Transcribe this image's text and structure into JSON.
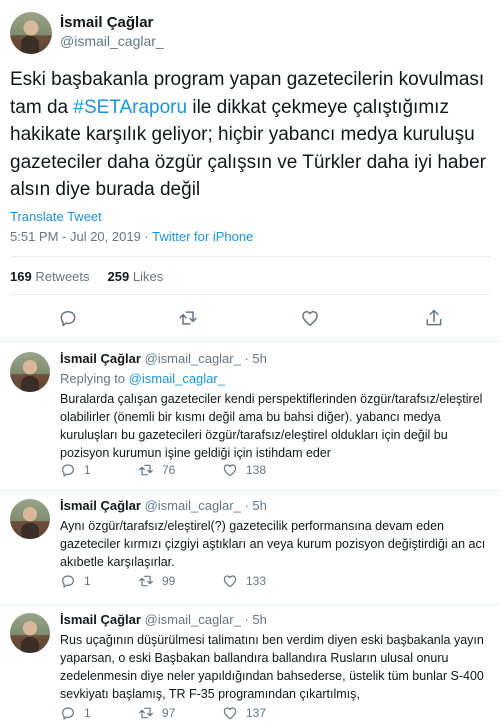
{
  "main": {
    "author_name": "İsmail Çağlar",
    "author_handle": "@ismail_caglar_",
    "text_before": "Eski başbakanla program yapan gazetecilerin kovulması tam da ",
    "hashtag": "#SETAraporu",
    "text_after": " ile dikkat çekmeye çalıştığımız hakikate karşılık geliyor; hiçbir yabancı medya kuruluşu gazeteciler daha özgür çalışsın ve Türkler daha iyi haber alsın diye burada değil",
    "translate": "Translate Tweet",
    "timestamp": "5:51 PM - Jul 20, 2019",
    "separator": " · ",
    "source": "Twitter for iPhone",
    "retweets_count": "169",
    "retweets_label": "Retweets",
    "likes_count": "259",
    "likes_label": "Likes"
  },
  "replies": [
    {
      "name": "İsmail Çağlar",
      "handle": "@ismail_caglar_",
      "time": "5h",
      "replying_label": "Replying to",
      "replying_to": "@ismail_caglar_",
      "text": "Buralarda çalışan gazeteciler kendi perspektiflerinden özgür/tarafsız/eleştirel olabilirler (önemli bir kısmı değil ama bu bahsi diğer). yabancı medya kuruluşları bu gazetecileri özgür/tarafsız/eleştirel oldukları için değil bu pozisyon kurumun işine geldiği için istihdam eder",
      "replies": "1",
      "retweets": "76",
      "likes": "138"
    },
    {
      "name": "İsmail Çağlar",
      "handle": "@ismail_caglar_",
      "time": "5h",
      "text": "Aynı özgür/tarafsız/eleştirel(?) gazetecilik performansına devam eden gazeteciler kırmızı çizgiyi aştıkları an veya kurum pozisyon değiştirdiği an acı akıbetle karşılaşırlar.",
      "replies": "1",
      "retweets": "99",
      "likes": "133"
    },
    {
      "name": "İsmail Çağlar",
      "handle": "@ismail_caglar_",
      "time": "5h",
      "text": "Rus uçağının düşürülmesi talimatını ben verdim diyen eski başbakanla yayın yaparsan, o eski Başbakan ballandıra ballandıra Rusların ulusal onuru zedelenmesin diye neler yapıldığından bahsederse, üstelik tüm bunlar S-400 sevkiyatı başlamış, TR F-35 programından çıkartılmış,",
      "replies": "1",
      "retweets": "97",
      "likes": "137"
    }
  ],
  "colors": {
    "link": "#1b95e0",
    "muted": "#657786",
    "text": "#14171a",
    "border": "#e6ecf0"
  },
  "icons": [
    "reply-icon",
    "retweet-icon",
    "like-icon",
    "share-icon"
  ]
}
